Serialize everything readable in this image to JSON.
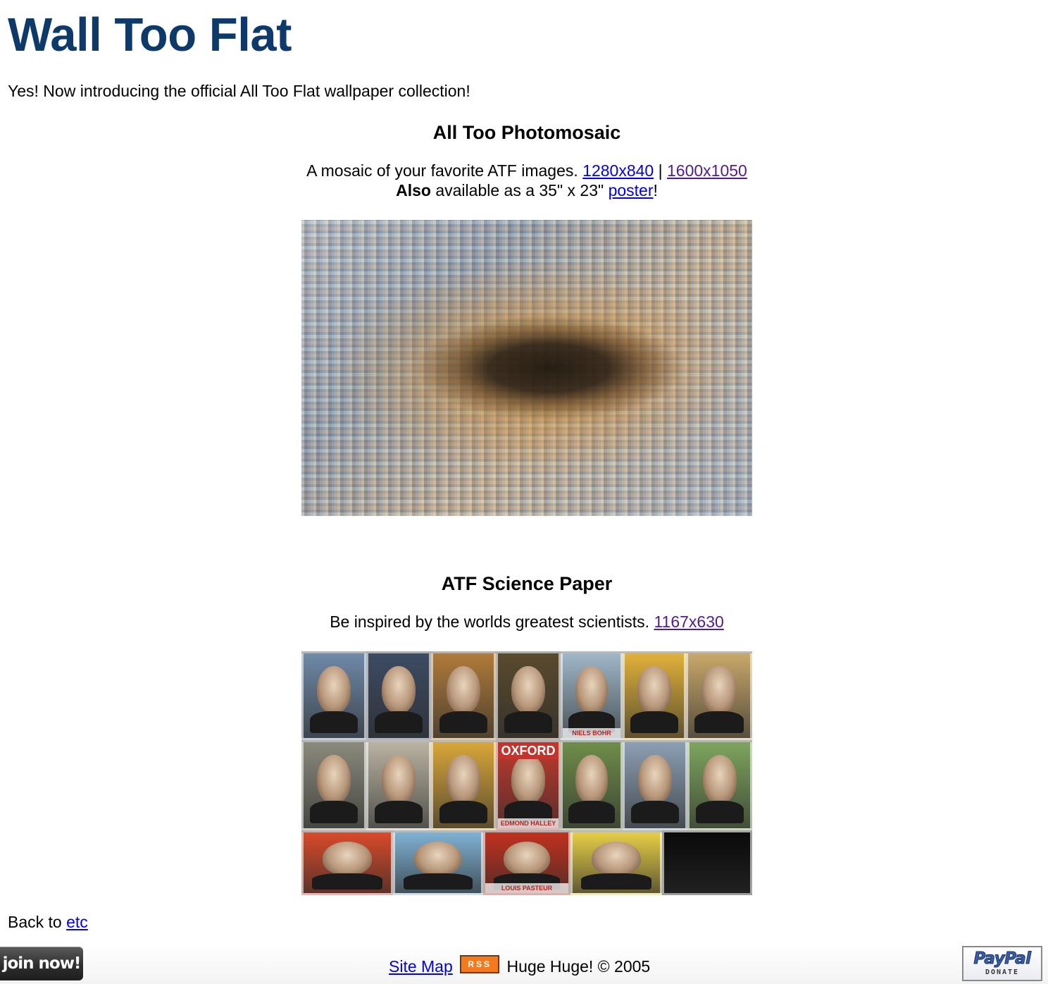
{
  "header": {
    "title": "Wall Too Flat",
    "intro": "Yes! Now introducing the official All Too Flat wallpaper collection!"
  },
  "sections": [
    {
      "title": "All Too Photomosaic",
      "description": "A mosaic of your favorite ATF images.",
      "links": [
        "1280x840",
        "1600x1050"
      ],
      "separator": "|",
      "poster_line": {
        "bold": "Also",
        "text": "available as a 35\" x 23\"",
        "link": "poster",
        "end": "!"
      }
    },
    {
      "title": "ATF Science Paper",
      "description": "Be inspired by the worlds greatest scientists.",
      "links": [
        "1167x630"
      ]
    }
  ],
  "science_cards": {
    "oxford": "OXFORD",
    "captions": [
      "",
      "",
      "",
      "",
      "NIELS BOHR",
      "",
      "",
      "",
      "",
      "",
      "EDMOND HALLEY",
      "",
      "",
      "",
      "",
      "",
      "LOUIS PASTEUR",
      "",
      ""
    ]
  },
  "back": {
    "text": "Back to",
    "link": "etc"
  },
  "footer": {
    "join_label": "join now!",
    "sitemap_label": "Site Map",
    "rss_label": "RSS",
    "copyright": "Huge Huge! © 2005",
    "paypal_logo": "PayPal",
    "paypal_donate": "DONATE"
  }
}
